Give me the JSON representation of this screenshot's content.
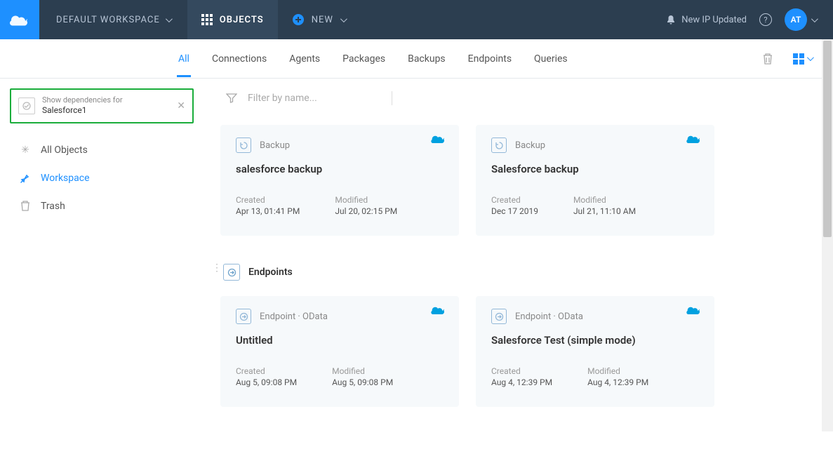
{
  "topbar": {
    "workspace_label": "DEFAULT WORKSPACE",
    "objects_label": "OBJECTS",
    "new_label": "NEW",
    "notification_text": "New IP Updated",
    "avatar_initials": "AT"
  },
  "subnav": {
    "tabs": [
      {
        "label": "All",
        "active": true
      },
      {
        "label": "Connections",
        "active": false
      },
      {
        "label": "Agents",
        "active": false
      },
      {
        "label": "Packages",
        "active": false
      },
      {
        "label": "Backups",
        "active": false
      },
      {
        "label": "Endpoints",
        "active": false
      },
      {
        "label": "Queries",
        "active": false
      }
    ]
  },
  "sidebar": {
    "dependencies_label": "Show dependencies for",
    "dependencies_value": "Salesforce1",
    "items": [
      {
        "label": "All Objects",
        "icon": "asterisk",
        "active": false
      },
      {
        "label": "Workspace",
        "icon": "pin",
        "active": true
      },
      {
        "label": "Trash",
        "icon": "trash",
        "active": false
      }
    ]
  },
  "main": {
    "filter_placeholder": "Filter by name...",
    "sections": [
      {
        "title": null,
        "cards": [
          {
            "type_label": "Backup",
            "title": "salesforce backup",
            "created_label": "Created",
            "created_value": "Apr 13, 01:41 PM",
            "modified_label": "Modified",
            "modified_value": "Jul 20, 02:15 PM"
          },
          {
            "type_label": "Backup",
            "title": "Salesforce backup",
            "created_label": "Created",
            "created_value": "Dec 17 2019",
            "modified_label": "Modified",
            "modified_value": "Jul 21, 11:10 AM"
          }
        ]
      },
      {
        "title": "Endpoints",
        "cards": [
          {
            "type_label": "Endpoint · OData",
            "title": "Untitled",
            "created_label": "Created",
            "created_value": "Aug 5, 09:08 PM",
            "modified_label": "Modified",
            "modified_value": "Aug 5, 09:08 PM"
          },
          {
            "type_label": "Endpoint · OData",
            "title": "Salesforce Test (simple mode)",
            "created_label": "Created",
            "created_value": "Aug 4, 12:39 PM",
            "modified_label": "Modified",
            "modified_value": "Aug 4, 12:39 PM"
          }
        ]
      }
    ]
  }
}
